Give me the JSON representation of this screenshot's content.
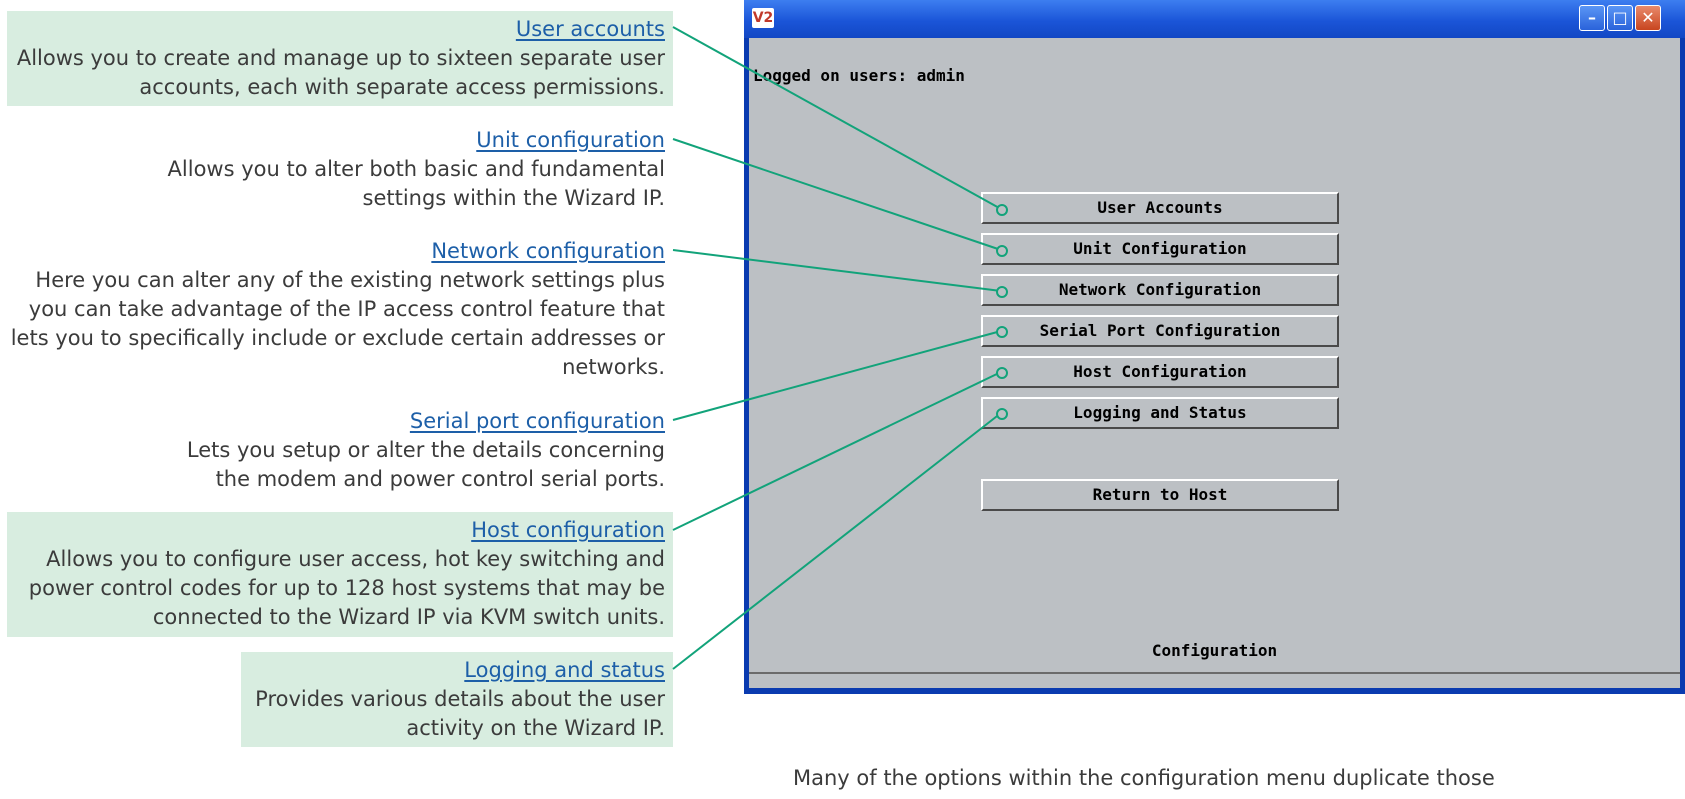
{
  "annotations": [
    {
      "title": "User accounts",
      "lines": [
        "Allows you to create and manage up to sixteen separate user",
        "accounts, each with separate access permissions."
      ]
    },
    {
      "title": "Unit configuration",
      "lines": [
        "Allows you to alter both basic and fundamental",
        "settings within the Wizard IP."
      ]
    },
    {
      "title": "Network configuration",
      "lines": [
        "Here you can alter any of the existing network settings plus",
        "you can take advantage of the IP access control feature that",
        "lets you to specifically include or exclude certain addresses or",
        "networks."
      ]
    },
    {
      "title": "Serial port configuration",
      "lines": [
        "Lets you setup or alter the details concerning",
        "the modem and power control serial ports."
      ]
    },
    {
      "title": "Host configuration",
      "lines": [
        "Allows you to configure user access, hot key switching and",
        "power control codes for up to 128 host systems that may be",
        "connected to the Wizard IP via KVM switch units."
      ]
    },
    {
      "title": "Logging and status",
      "lines": [
        "Provides various details about the user",
        "activity on the Wizard IP."
      ]
    }
  ],
  "window": {
    "icon_text": "V2",
    "logged_on_text": "Logged on users:  admin",
    "buttons": {
      "user_accounts": "User Accounts",
      "unit_config": "Unit Configuration",
      "network_config": "Network Configuration",
      "serial_config": "Serial Port Configuration",
      "host_config": "Host Configuration",
      "logging": "Logging and Status",
      "return_host": "Return to Host"
    },
    "status_text": "Configuration"
  },
  "caption": "Many of the options within the configuration menu duplicate those",
  "colors": {
    "leader_line": "#12a37a",
    "link": "#1d5fa8",
    "shade": "#d8ede0"
  }
}
